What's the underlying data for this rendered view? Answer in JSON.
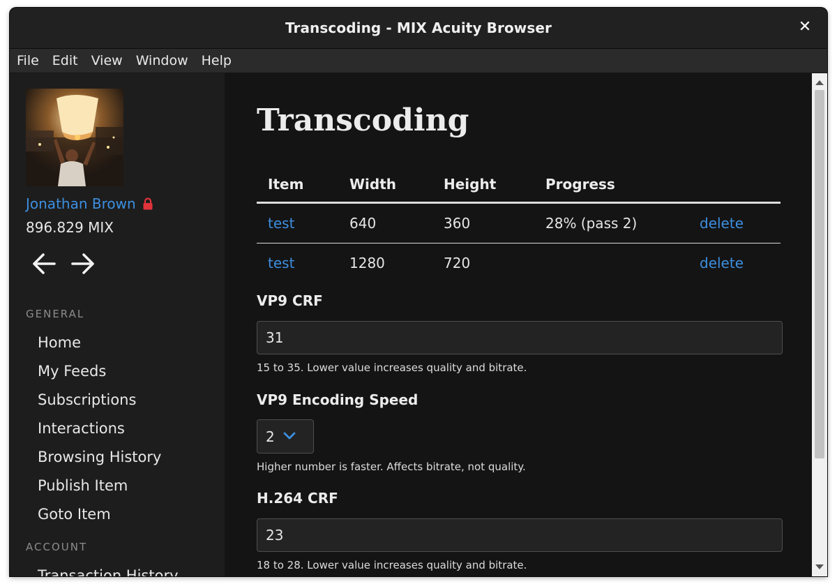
{
  "window": {
    "title": "Transcoding - MIX Acuity Browser",
    "close_glyph": "✕"
  },
  "menu": [
    "File",
    "Edit",
    "View",
    "Window",
    "Help"
  ],
  "sidebar": {
    "user_name": "Jonathan Brown",
    "balance": "896.829 MIX",
    "sections": {
      "general": "GENERAL",
      "account": "ACCOUNT"
    },
    "general_items": [
      "Home",
      "My Feeds",
      "Subscriptions",
      "Interactions",
      "Browsing History",
      "Publish Item",
      "Goto Item"
    ],
    "account_items": [
      "Transaction History"
    ]
  },
  "main": {
    "title": "Transcoding",
    "table": {
      "headers": [
        "Item",
        "Width",
        "Height",
        "Progress",
        ""
      ],
      "rows": [
        {
          "item": "test",
          "width": "640",
          "height": "360",
          "progress": "28% (pass 2)",
          "action": "delete"
        },
        {
          "item": "test",
          "width": "1280",
          "height": "720",
          "progress": "",
          "action": "delete"
        }
      ]
    },
    "vp9_crf": {
      "label": "VP9 CRF",
      "value": "31",
      "help": "15 to 35. Lower value increases quality and bitrate."
    },
    "vp9_speed": {
      "label": "VP9 Encoding Speed",
      "value": "2",
      "help": "Higher number is faster. Affects bitrate, not quality."
    },
    "h264_crf": {
      "label": "H.264 CRF",
      "value": "23",
      "help": "18 to 28. Lower value increases quality and bitrate."
    }
  },
  "colors": {
    "link": "#3d8fe0",
    "lock": "#e0333a",
    "background": "#141414",
    "sidebar": "#1d1d1d"
  }
}
